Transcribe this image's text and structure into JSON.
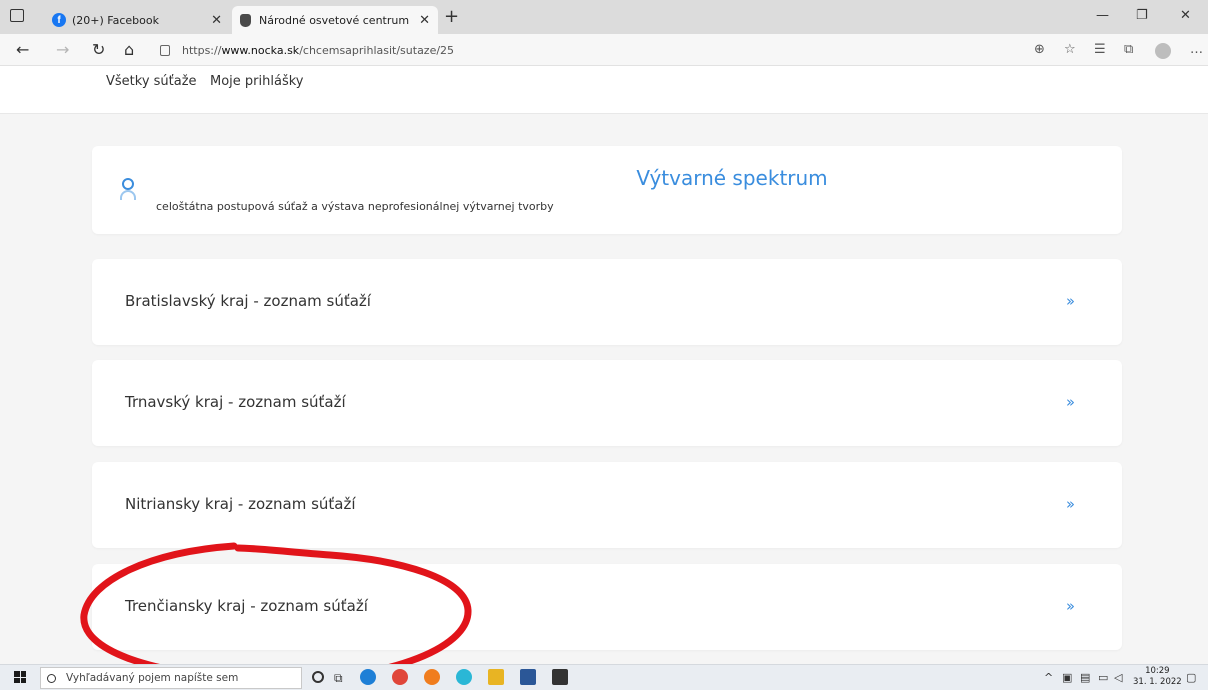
{
  "browser": {
    "tabs": [
      {
        "label": "(20+) Facebook",
        "icon": "facebook-icon"
      },
      {
        "label": "Národné osvetové centrum - pri",
        "icon": "site-icon"
      }
    ],
    "url_prefix": "https://",
    "url_host": "www.nocka.sk",
    "url_path": "/chcemsaprihlasit/sutaze/25"
  },
  "subnav": {
    "all_competitions": "Všetky súťaže",
    "my_applications": "Moje prihlášky"
  },
  "header_card": {
    "title": "Výtvarné spektrum",
    "subtitle": "celoštátna postupová súťaž a výstava neprofesionálnej výtvarnej tvorby"
  },
  "regions": [
    "Bratislavský kraj - zoznam súťaží",
    "Trnavský kraj - zoznam súťaží",
    "Nitriansky kraj - zoznam súťaží",
    "Trenčiansky kraj - zoznam súťaží"
  ],
  "colors": {
    "accent": "#3a8dde",
    "annotation": "#e1141a"
  },
  "taskbar": {
    "search_placeholder": "Vyhľadávaný pojem napíšte sem",
    "time": "10:29",
    "date": "31. 1. 2022"
  }
}
